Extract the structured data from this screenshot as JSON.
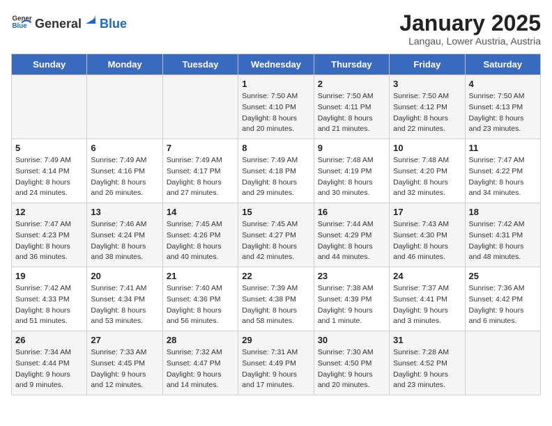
{
  "logo": {
    "general": "General",
    "blue": "Blue"
  },
  "title": "January 2025",
  "subtitle": "Langau, Lower Austria, Austria",
  "headers": [
    "Sunday",
    "Monday",
    "Tuesday",
    "Wednesday",
    "Thursday",
    "Friday",
    "Saturday"
  ],
  "rows": [
    [
      {
        "day": "",
        "info": ""
      },
      {
        "day": "",
        "info": ""
      },
      {
        "day": "",
        "info": ""
      },
      {
        "day": "1",
        "info": "Sunrise: 7:50 AM\nSunset: 4:10 PM\nDaylight: 8 hours\nand 20 minutes."
      },
      {
        "day": "2",
        "info": "Sunrise: 7:50 AM\nSunset: 4:11 PM\nDaylight: 8 hours\nand 21 minutes."
      },
      {
        "day": "3",
        "info": "Sunrise: 7:50 AM\nSunset: 4:12 PM\nDaylight: 8 hours\nand 22 minutes."
      },
      {
        "day": "4",
        "info": "Sunrise: 7:50 AM\nSunset: 4:13 PM\nDaylight: 8 hours\nand 23 minutes."
      }
    ],
    [
      {
        "day": "5",
        "info": "Sunrise: 7:49 AM\nSunset: 4:14 PM\nDaylight: 8 hours\nand 24 minutes."
      },
      {
        "day": "6",
        "info": "Sunrise: 7:49 AM\nSunset: 4:16 PM\nDaylight: 8 hours\nand 26 minutes."
      },
      {
        "day": "7",
        "info": "Sunrise: 7:49 AM\nSunset: 4:17 PM\nDaylight: 8 hours\nand 27 minutes."
      },
      {
        "day": "8",
        "info": "Sunrise: 7:49 AM\nSunset: 4:18 PM\nDaylight: 8 hours\nand 29 minutes."
      },
      {
        "day": "9",
        "info": "Sunrise: 7:48 AM\nSunset: 4:19 PM\nDaylight: 8 hours\nand 30 minutes."
      },
      {
        "day": "10",
        "info": "Sunrise: 7:48 AM\nSunset: 4:20 PM\nDaylight: 8 hours\nand 32 minutes."
      },
      {
        "day": "11",
        "info": "Sunrise: 7:47 AM\nSunset: 4:22 PM\nDaylight: 8 hours\nand 34 minutes."
      }
    ],
    [
      {
        "day": "12",
        "info": "Sunrise: 7:47 AM\nSunset: 4:23 PM\nDaylight: 8 hours\nand 36 minutes."
      },
      {
        "day": "13",
        "info": "Sunrise: 7:46 AM\nSunset: 4:24 PM\nDaylight: 8 hours\nand 38 minutes."
      },
      {
        "day": "14",
        "info": "Sunrise: 7:45 AM\nSunset: 4:26 PM\nDaylight: 8 hours\nand 40 minutes."
      },
      {
        "day": "15",
        "info": "Sunrise: 7:45 AM\nSunset: 4:27 PM\nDaylight: 8 hours\nand 42 minutes."
      },
      {
        "day": "16",
        "info": "Sunrise: 7:44 AM\nSunset: 4:29 PM\nDaylight: 8 hours\nand 44 minutes."
      },
      {
        "day": "17",
        "info": "Sunrise: 7:43 AM\nSunset: 4:30 PM\nDaylight: 8 hours\nand 46 minutes."
      },
      {
        "day": "18",
        "info": "Sunrise: 7:42 AM\nSunset: 4:31 PM\nDaylight: 8 hours\nand 48 minutes."
      }
    ],
    [
      {
        "day": "19",
        "info": "Sunrise: 7:42 AM\nSunset: 4:33 PM\nDaylight: 8 hours\nand 51 minutes."
      },
      {
        "day": "20",
        "info": "Sunrise: 7:41 AM\nSunset: 4:34 PM\nDaylight: 8 hours\nand 53 minutes."
      },
      {
        "day": "21",
        "info": "Sunrise: 7:40 AM\nSunset: 4:36 PM\nDaylight: 8 hours\nand 56 minutes."
      },
      {
        "day": "22",
        "info": "Sunrise: 7:39 AM\nSunset: 4:38 PM\nDaylight: 8 hours\nand 58 minutes."
      },
      {
        "day": "23",
        "info": "Sunrise: 7:38 AM\nSunset: 4:39 PM\nDaylight: 9 hours\nand 1 minute."
      },
      {
        "day": "24",
        "info": "Sunrise: 7:37 AM\nSunset: 4:41 PM\nDaylight: 9 hours\nand 3 minutes."
      },
      {
        "day": "25",
        "info": "Sunrise: 7:36 AM\nSunset: 4:42 PM\nDaylight: 9 hours\nand 6 minutes."
      }
    ],
    [
      {
        "day": "26",
        "info": "Sunrise: 7:34 AM\nSunset: 4:44 PM\nDaylight: 9 hours\nand 9 minutes."
      },
      {
        "day": "27",
        "info": "Sunrise: 7:33 AM\nSunset: 4:45 PM\nDaylight: 9 hours\nand 12 minutes."
      },
      {
        "day": "28",
        "info": "Sunrise: 7:32 AM\nSunset: 4:47 PM\nDaylight: 9 hours\nand 14 minutes."
      },
      {
        "day": "29",
        "info": "Sunrise: 7:31 AM\nSunset: 4:49 PM\nDaylight: 9 hours\nand 17 minutes."
      },
      {
        "day": "30",
        "info": "Sunrise: 7:30 AM\nSunset: 4:50 PM\nDaylight: 9 hours\nand 20 minutes."
      },
      {
        "day": "31",
        "info": "Sunrise: 7:28 AM\nSunset: 4:52 PM\nDaylight: 9 hours\nand 23 minutes."
      },
      {
        "day": "",
        "info": ""
      }
    ]
  ]
}
